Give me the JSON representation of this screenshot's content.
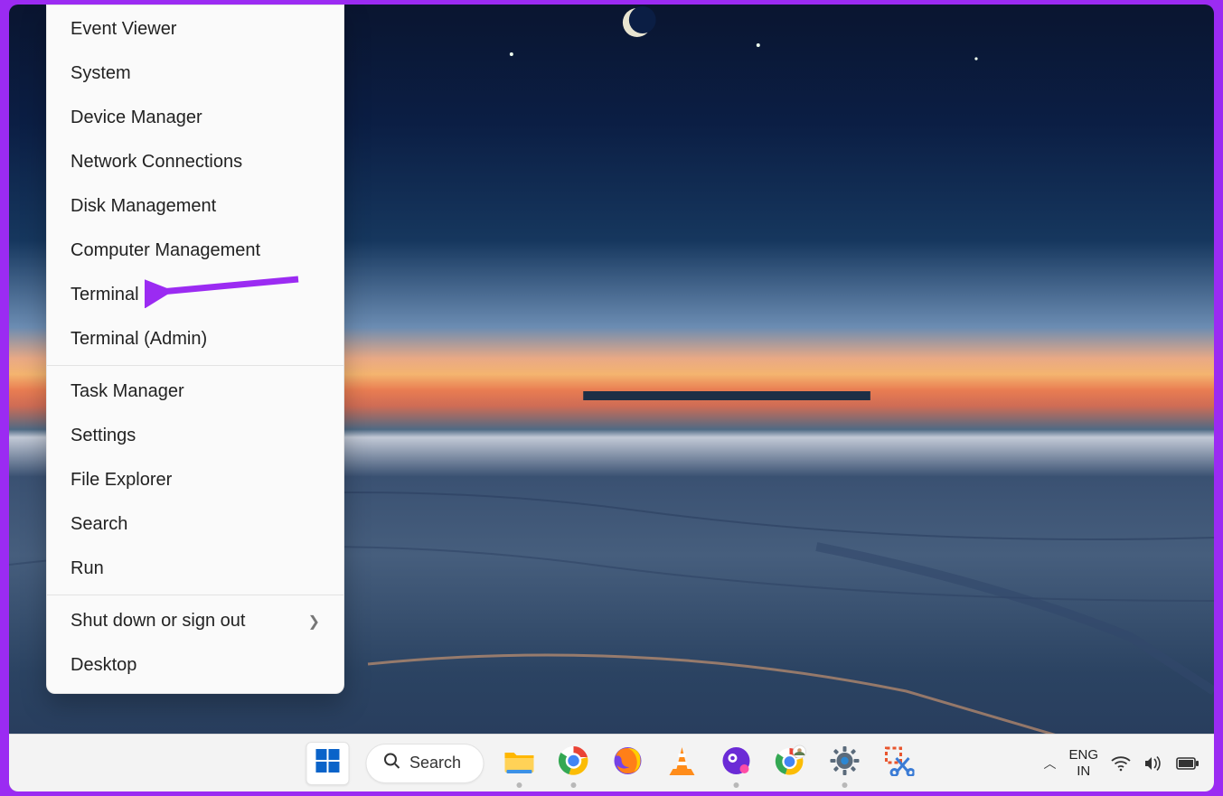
{
  "annotation": {
    "border_color": "#9b2bf2",
    "arrow_color": "#9b2bf2",
    "arrow_points_to": "Terminal"
  },
  "context_menu": {
    "items": [
      {
        "label": "Event Viewer",
        "submenu": false
      },
      {
        "label": "System",
        "submenu": false
      },
      {
        "label": "Device Manager",
        "submenu": false
      },
      {
        "label": "Network Connections",
        "submenu": false
      },
      {
        "label": "Disk Management",
        "submenu": false
      },
      {
        "label": "Computer Management",
        "submenu": false
      },
      {
        "label": "Terminal",
        "submenu": false
      },
      {
        "label": "Terminal (Admin)",
        "submenu": false
      }
    ],
    "items_group2": [
      {
        "label": "Task Manager",
        "submenu": false
      },
      {
        "label": "Settings",
        "submenu": false
      },
      {
        "label": "File Explorer",
        "submenu": false
      },
      {
        "label": "Search",
        "submenu": false
      },
      {
        "label": "Run",
        "submenu": false
      }
    ],
    "items_group3": [
      {
        "label": "Shut down or sign out",
        "submenu": true
      },
      {
        "label": "Desktop",
        "submenu": false
      }
    ]
  },
  "taskbar": {
    "search_label": "Search",
    "pinned": [
      {
        "name": "start",
        "icon": "windows-logo"
      },
      {
        "name": "search",
        "icon": "search-icon"
      },
      {
        "name": "file-explorer",
        "icon": "folder-icon",
        "running": true
      },
      {
        "name": "chrome",
        "icon": "chrome-icon",
        "running": true
      },
      {
        "name": "firefox",
        "icon": "firefox-icon",
        "running": false
      },
      {
        "name": "vlc",
        "icon": "vlc-icon",
        "running": false
      },
      {
        "name": "app-purple",
        "icon": "purple-circle-icon",
        "running": true
      },
      {
        "name": "chrome-profile",
        "icon": "chrome-profile-icon",
        "running": false
      },
      {
        "name": "settings",
        "icon": "gear-icon",
        "running": true
      },
      {
        "name": "snipping-tool",
        "icon": "snip-icon",
        "running": false
      }
    ],
    "systray": {
      "overflow_chevron": "chevron-up-icon",
      "language_line1": "ENG",
      "language_line2": "IN",
      "wifi": "wifi-icon",
      "volume": "speaker-icon",
      "battery": "battery-icon"
    }
  }
}
